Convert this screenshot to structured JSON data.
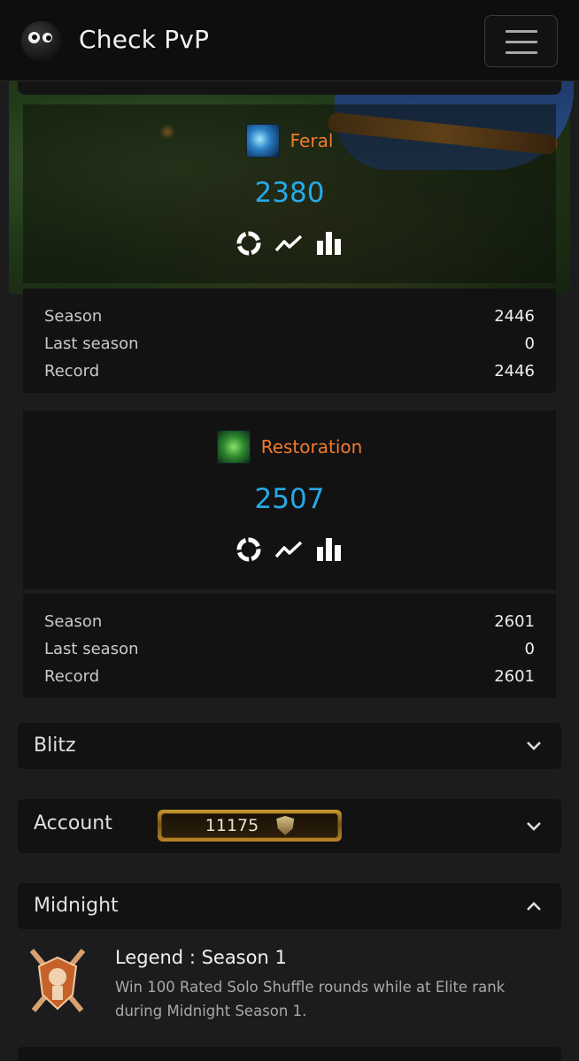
{
  "app": {
    "title": "Check PvP"
  },
  "icons": {
    "logo": "googly-eyes-logo",
    "menu": "hamburger-icon",
    "spec_actions": [
      "donut-chart-icon",
      "trend-line-icon",
      "bar-chart-icon"
    ],
    "chevron_down": "chevron-down-icon",
    "chevron_up": "chevron-up-icon"
  },
  "colors": {
    "spec_name": "#f07a2c",
    "rating": "#26a9e8",
    "background": "#1c1c1e",
    "panel": "#121212"
  },
  "specs": [
    {
      "name": "Feral",
      "icon": "feral-claw-icon",
      "rating": "2380",
      "stats": [
        {
          "label": "Season",
          "value": "2446"
        },
        {
          "label": "Last season",
          "value": "0"
        },
        {
          "label": "Record",
          "value": "2446"
        }
      ]
    },
    {
      "name": "Restoration",
      "icon": "restoration-leaf-icon",
      "rating": "2507",
      "stats": [
        {
          "label": "Season",
          "value": "2601"
        },
        {
          "label": "Last season",
          "value": "0"
        },
        {
          "label": "Record",
          "value": "2601"
        }
      ]
    }
  ],
  "sections": {
    "blitz": {
      "title": "Blitz",
      "expanded": false
    },
    "account": {
      "title": "Account",
      "badge_value": "11175",
      "expanded": false
    },
    "midnight": {
      "title": "Midnight",
      "expanded": true
    }
  },
  "achievement": {
    "icon": "legend-crossed-swords-shield-icon",
    "title": "Legend : Season 1",
    "description": "Win 100 Rated Solo Shuffle rounds while at Elite rank during Midnight Season 1."
  }
}
